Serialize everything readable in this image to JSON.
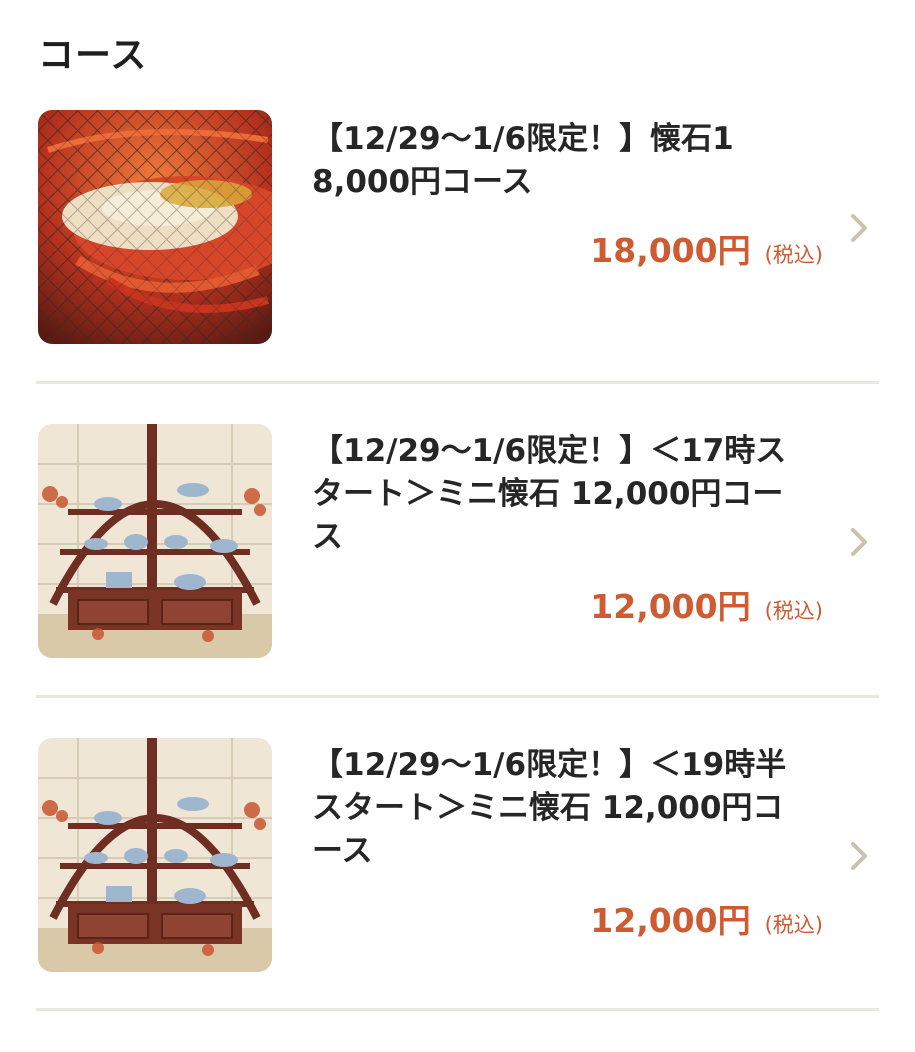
{
  "section": {
    "title": "コース"
  },
  "courses": [
    {
      "name": "【12/29〜1/6限定！】懐石18,000円コース",
      "price": "18,000円",
      "tax_label": "(税込)",
      "image": "grilled-lobster-photo"
    },
    {
      "name": "【12/29〜1/6限定！】＜17時スタート＞ミニ懐石 12,000円コース",
      "price": "12,000円",
      "tax_label": "(税込)",
      "image": "fan-shaped-kaiseki-display-photo"
    },
    {
      "name": "【12/29〜1/6限定！】＜19時半スタート＞ミニ懐石 12,000円コース",
      "price": "12,000円",
      "tax_label": "(税込)",
      "image": "fan-shaped-kaiseki-display-photo"
    }
  ],
  "icons": {
    "chevron": "chevron-right-icon"
  },
  "colors": {
    "price": "#cf5b33",
    "divider": "#e9e8df",
    "chevron": "#c9c2ad"
  }
}
